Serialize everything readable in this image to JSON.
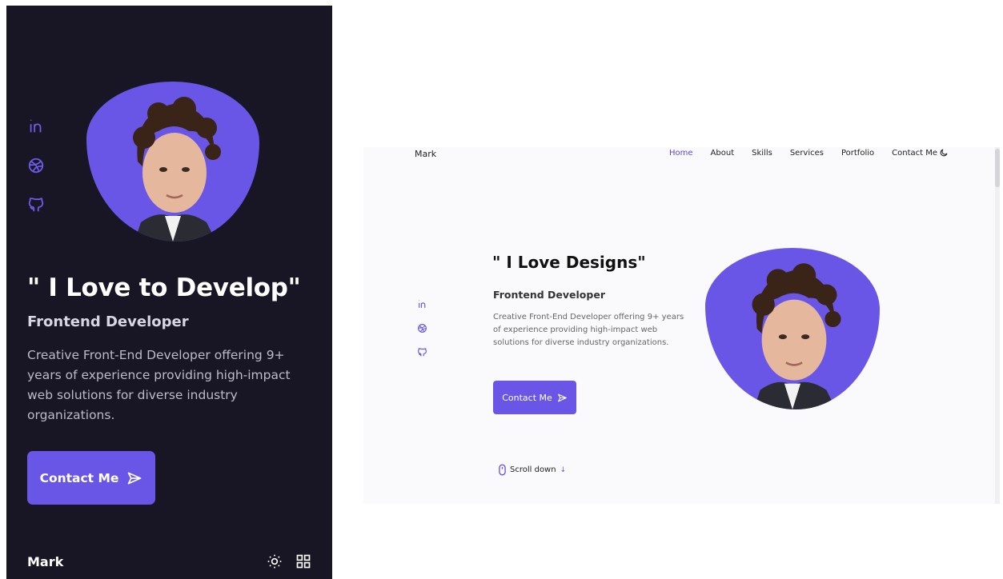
{
  "mobile": {
    "title": "\" I Love to Develop\"",
    "subtitle": "Frontend Developer",
    "description": "Creative Front-End Developer offering 9+ years of experience providing high-impact web solutions for diverse industry organizations.",
    "contact_label": "Contact Me",
    "footer": {
      "logo": "Mark",
      "icons": [
        "sun-icon",
        "grid-menu-icon"
      ]
    },
    "social_icons": [
      "linkedin-icon",
      "dribbble-icon",
      "github-icon"
    ]
  },
  "desktop": {
    "nav": {
      "logo": "Mark",
      "items": [
        {
          "label": "Home",
          "active": true
        },
        {
          "label": "About",
          "active": false
        },
        {
          "label": "Skills",
          "active": false
        },
        {
          "label": "Services",
          "active": false
        },
        {
          "label": "Portfolio",
          "active": false
        },
        {
          "label": "Contact Me",
          "active": false
        }
      ],
      "theme_icon": "moon-icon"
    },
    "title": "\" I Love Designs\"",
    "subtitle": "Frontend Developer",
    "description": "Creative Front-End Developer offering 9+ years of experience providing high-impact web solutions for diverse industry organizations.",
    "contact_label": "Contact Me",
    "scroll_label": "Scroll down",
    "scroll_arrow": "↓",
    "social_icons": [
      "linkedin-icon",
      "dribbble-icon",
      "github-icon"
    ]
  },
  "colors": {
    "accent": "#6a56e6",
    "dark_bg": "#181525",
    "light_bg": "#fafafc"
  }
}
